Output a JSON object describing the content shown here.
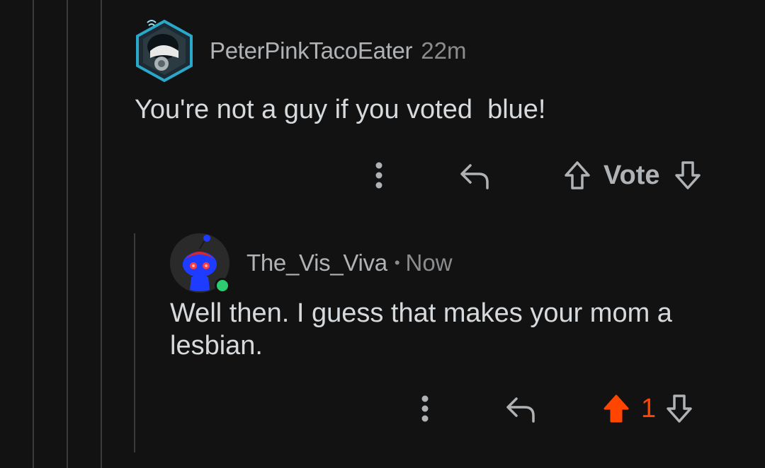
{
  "comments": [
    {
      "username": "PeterPinkTacoEater",
      "time": "22m",
      "body": "You're not a guy if you voted  blue!",
      "vote_label": "Vote",
      "avatar_icon": "robot-hex-avatar-icon"
    },
    {
      "username": "The_Vis_Viva",
      "separator": "•",
      "time": "Now",
      "body": "Well then. I guess that makes your mom a\nlesbian.",
      "vote_count": "1",
      "upvoted": true,
      "online": true,
      "avatar_icon": "snoo-avatar-icon"
    }
  ],
  "colors": {
    "background": "#121212",
    "upvote_active": "#ff4500",
    "online_dot": "#2ecc71",
    "avatar_ring": "#2aa7c9"
  }
}
